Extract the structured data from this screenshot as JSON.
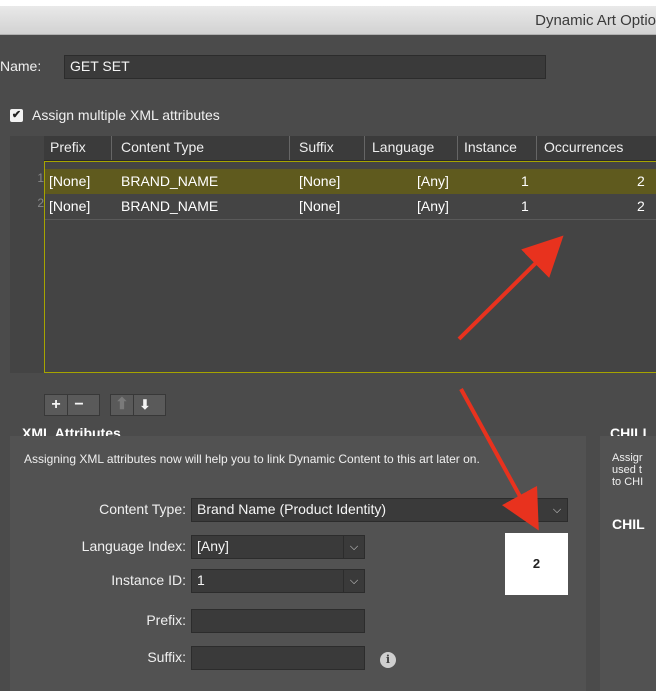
{
  "window": {
    "title": "Dynamic Art Optio"
  },
  "name_field": {
    "label": "Name:",
    "value": "GET SET"
  },
  "assign_checkbox": {
    "label": "Assign multiple XML attributes",
    "checked": true
  },
  "table": {
    "columns": [
      "Prefix",
      "Content Type",
      "Suffix",
      "Language",
      "Instance",
      "Occurrences"
    ],
    "rows": [
      {
        "num": "1",
        "prefix": "[None]",
        "content_type": "BRAND_NAME",
        "suffix": "[None]",
        "language": "[Any]",
        "instance": "1",
        "occurrences": "2",
        "selected": true
      },
      {
        "num": "2",
        "prefix": "[None]",
        "content_type": "BRAND_NAME",
        "suffix": "[None]",
        "language": "[Any]",
        "instance": "1",
        "occurrences": "2",
        "selected": false
      }
    ],
    "selection_color": "#5f5a1e",
    "border_color": "#a6a400"
  },
  "toolbar": {
    "add_label": "+",
    "remove_label": "−",
    "up_label": "⬆",
    "down_label": "⬇"
  },
  "xml_attributes": {
    "heading": "XML Attributes",
    "description": "Assigning XML attributes now will help you to link Dynamic Content to this art later on.",
    "content_type_label": "Content Type:",
    "content_type_value": "Brand Name (Product Identity)",
    "language_index_label": "Language Index:",
    "language_index_value": "[Any]",
    "instance_id_label": "Instance ID:",
    "instance_id_value": "1",
    "prefix_label": "Prefix:",
    "prefix_value": "",
    "suffix_label": "Suffix:",
    "suffix_value": "",
    "info_icon": "i"
  },
  "chili_panel": {
    "heading": "CHILI",
    "text_line1": "Assigr",
    "text_line2": "used t",
    "text_line3": "to CHI",
    "subheading": "CHIL"
  },
  "annotation": {
    "badge_text": "2",
    "arrow_color": "#e8321e"
  }
}
